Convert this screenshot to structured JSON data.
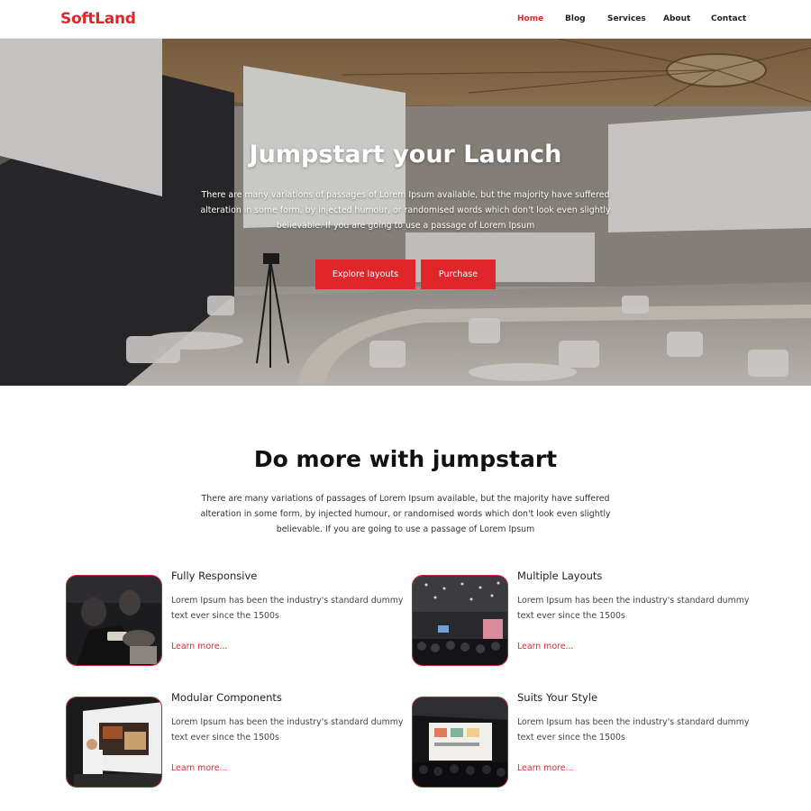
{
  "brand": {
    "logo": "SoftLand",
    "accent": "#e0262a"
  },
  "nav": {
    "items": [
      {
        "label": "Home",
        "active": true
      },
      {
        "label": "Blog",
        "active": false
      },
      {
        "label": "Services",
        "active": false
      },
      {
        "label": "About",
        "active": false
      },
      {
        "label": "Contact",
        "active": false
      }
    ]
  },
  "hero": {
    "title": "Jumpstart your Launch",
    "text": "There are many variations of passages of Lorem Ipsum available, but the majority have suffered alteration in some form, by injected humour, or randomised words which don't look even slightly believable. If you are going to use a passage of Lorem Ipsum",
    "buttons": {
      "explore": "Explore layouts",
      "purchase": "Purchase"
    }
  },
  "section": {
    "title": "Do more with jumpstart",
    "text": "There are many variations of passages of Lorem Ipsum available, but the majority have suffered alteration in some form, by injected humour, or randomised words which don't look even slightly believable. If you are going to use a passage of Lorem Ipsum"
  },
  "features": [
    {
      "title": "Fully Responsive",
      "text": "Lorem Ipsum has been the industry's standard dummy text ever since the 1500s",
      "link": "Learn more..."
    },
    {
      "title": "Multiple Layouts",
      "text": "Lorem Ipsum has been the industry's standard dummy text ever since the 1500s",
      "link": "Learn more..."
    },
    {
      "title": "Modular Components",
      "text": "Lorem Ipsum has been the industry's standard dummy text ever since the 1500s",
      "link": "Learn more..."
    },
    {
      "title": "Suits Your Style",
      "text": "Lorem Ipsum has been the industry's standard dummy text ever since the 1500s",
      "link": "Learn more..."
    }
  ]
}
